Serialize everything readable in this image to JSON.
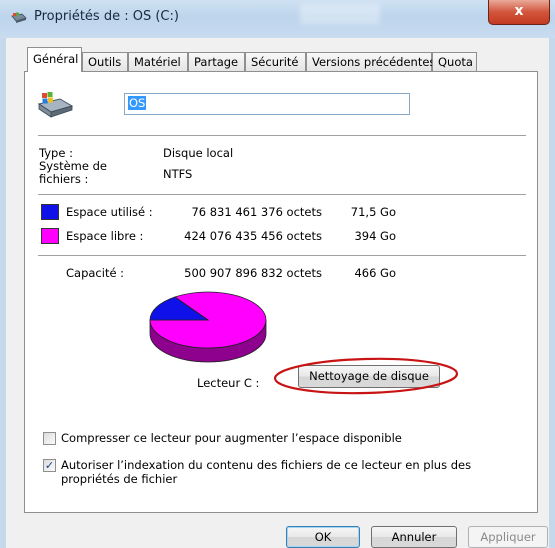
{
  "window": {
    "title": "Propriétés de : OS (C:)",
    "close_label": "x"
  },
  "tabs": [
    {
      "label": "Général",
      "active": true
    },
    {
      "label": "Outils"
    },
    {
      "label": "Matériel"
    },
    {
      "label": "Partage"
    },
    {
      "label": "Sécurité"
    },
    {
      "label": "Versions précédentes"
    },
    {
      "label": "Quota"
    }
  ],
  "general": {
    "drive_name": "OS",
    "type_label": "Type :",
    "type_value": "Disque local",
    "fs_label": "Système de fichiers :",
    "fs_value": "NTFS",
    "used_label": "Espace utilisé :",
    "used_bytes": "76 831 461 376 octets",
    "used_size": "71,5 Go",
    "free_label": "Espace libre :",
    "free_bytes": "424 076 435 456 octets",
    "free_size": "394 Go",
    "capacity_label": "Capacité :",
    "capacity_bytes": "500 907 896 832 octets",
    "capacity_size": "466 Go",
    "drive_label": "Lecteur C :",
    "cleanup_button": "Nettoyage de disque",
    "used_fraction": 0.1534,
    "colors": {
      "used": "#1010e8",
      "free": "#ff00ff",
      "highlight_circle": "#c81414"
    }
  },
  "options": {
    "compress_label": "Compresser ce lecteur pour augmenter l’espace disponible",
    "compress_checked": false,
    "index_label": "Autoriser l’indexation du contenu des fichiers de ce lecteur en plus des propriétés de fichier",
    "index_checked": true
  },
  "buttons": {
    "ok": "OK",
    "cancel": "Annuler",
    "apply": "Appliquer"
  }
}
